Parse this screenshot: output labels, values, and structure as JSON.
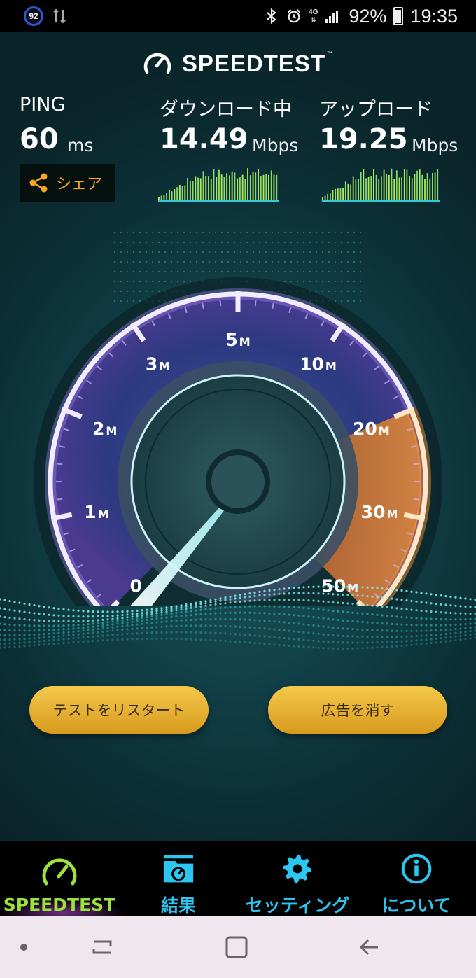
{
  "status_bar": {
    "notification_badge": "92",
    "network": "4G",
    "battery": "92%",
    "time": "19:35"
  },
  "header": {
    "logo_text": "SPEEDTEST",
    "logo_tm": "™"
  },
  "metrics": {
    "ping": {
      "label": "PING",
      "value": "60",
      "unit": "ms"
    },
    "download": {
      "label": "ダウンロード中",
      "value": "14.49",
      "unit": "Mbps"
    },
    "upload": {
      "label": "アップロード",
      "value": "19.25",
      "unit": "Mbps"
    }
  },
  "share": {
    "label": "シェア"
  },
  "gauge": {
    "labels": [
      {
        "num": "0",
        "unit": ""
      },
      {
        "num": "1",
        "unit": "M"
      },
      {
        "num": "2",
        "unit": "M"
      },
      {
        "num": "3",
        "unit": "M"
      },
      {
        "num": "5",
        "unit": "M"
      },
      {
        "num": "10",
        "unit": "M"
      },
      {
        "num": "20",
        "unit": "M"
      },
      {
        "num": "30",
        "unit": "M"
      },
      {
        "num": "50",
        "unit": "M"
      }
    ],
    "current_mbps": 14.49
  },
  "buttons": {
    "restart": "テストをリスタート",
    "remove_ads": "広告を消す"
  },
  "bottom_nav": {
    "items": [
      {
        "label": "SPEEDTEST",
        "icon": "speedometer-icon",
        "color": "#9be23a",
        "active": true
      },
      {
        "label": "結果",
        "icon": "results-folder-icon",
        "color": "#2bc7f0"
      },
      {
        "label": "セッティング",
        "icon": "gear-icon",
        "color": "#2bc7f0"
      },
      {
        "label": "について",
        "icon": "info-icon",
        "color": "#2bc7f0"
      }
    ]
  },
  "colors": {
    "accent_orange": "#f5a623",
    "gauge_purple": "#9c7ce0",
    "gauge_orange": "#f2933a",
    "nav_cyan": "#2bc7f0",
    "nav_green": "#9be23a"
  }
}
